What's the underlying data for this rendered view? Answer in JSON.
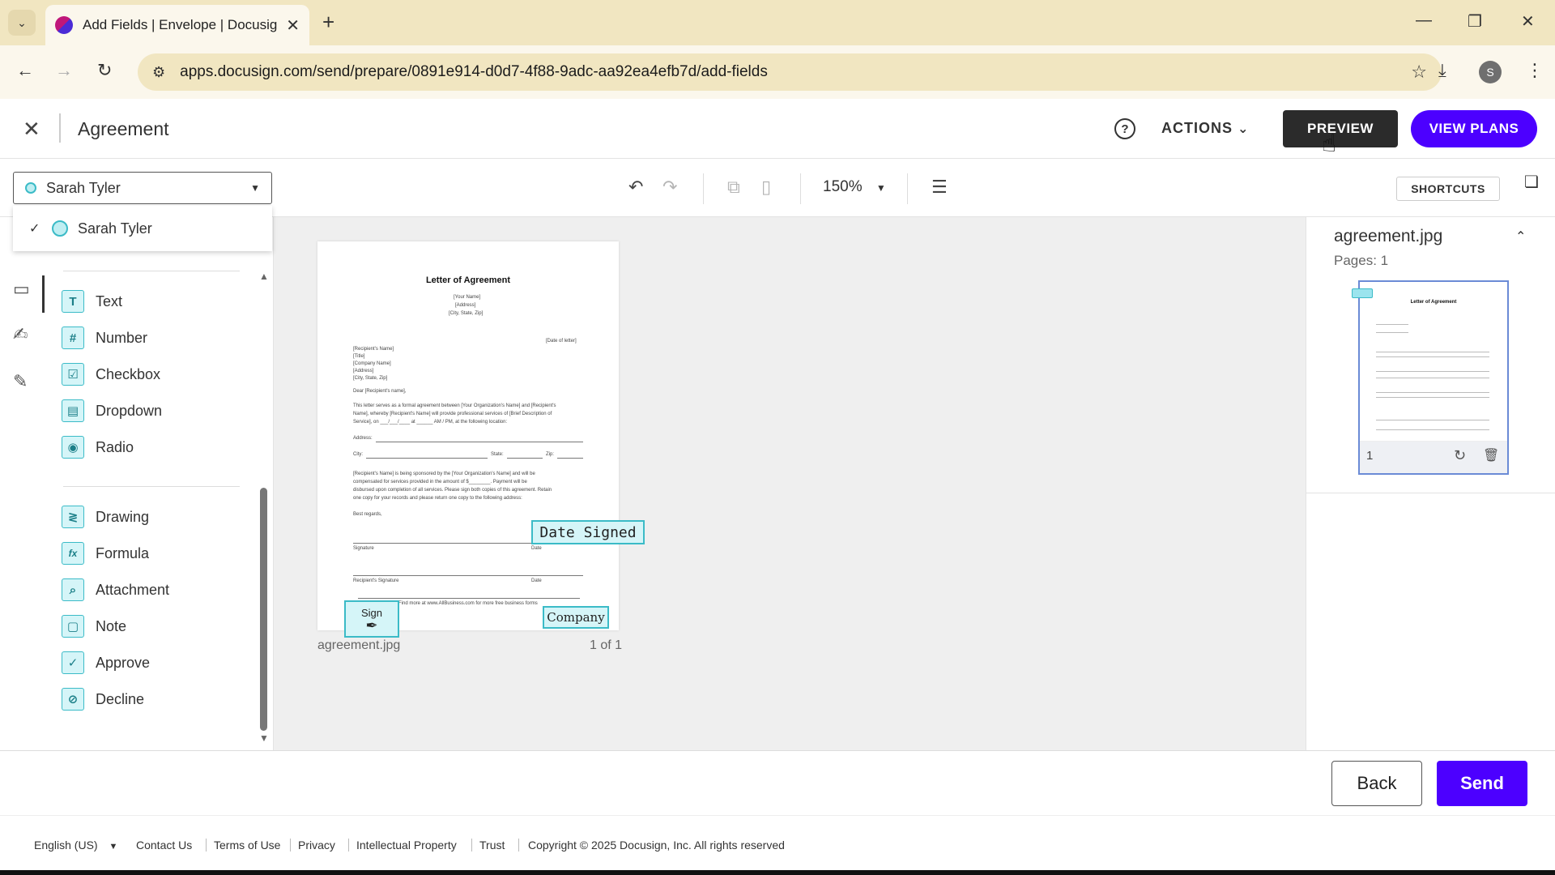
{
  "browser": {
    "tab_title": "Add Fields | Envelope | Docusig",
    "url": "apps.docusign.com/send/prepare/0891e914-d0d7-4f88-9adc-aa92ea4efb7d/add-fields",
    "profile_initial": "S"
  },
  "header": {
    "title": "Agreement",
    "actions_label": "ACTIONS",
    "preview_label": "PREVIEW",
    "view_plans_label": "VIEW PLANS"
  },
  "toolbar": {
    "recipient": "Sarah Tyler",
    "zoom": "150%",
    "shortcuts_label": "SHORTCUTS"
  },
  "recipient_menu": {
    "items": [
      {
        "name": "Sarah Tyler",
        "selected": true
      }
    ]
  },
  "palette": {
    "standard_fields": [
      {
        "label": "Text",
        "icon": "T"
      },
      {
        "label": "Number",
        "icon": "#"
      },
      {
        "label": "Checkbox",
        "icon": "☑"
      },
      {
        "label": "Dropdown",
        "icon": "▤"
      },
      {
        "label": "Radio",
        "icon": "◉"
      }
    ],
    "advanced_fields": [
      {
        "label": "Drawing",
        "icon": "≷"
      },
      {
        "label": "Formula",
        "icon": "fx"
      },
      {
        "label": "Attachment",
        "icon": "⌕"
      },
      {
        "label": "Note",
        "icon": "▢"
      },
      {
        "label": "Approve",
        "icon": "✓"
      },
      {
        "label": "Decline",
        "icon": "⊘"
      }
    ]
  },
  "document": {
    "heading": "Letter of Agreement",
    "sender_lines": [
      "[Your Name]",
      "[Address]",
      "[City, State, Zip]"
    ],
    "date_line": "[Date of letter]",
    "recipient_lines": [
      "[Recipient's Name]",
      "[Title]",
      "[Company Name]",
      "[Address]",
      "[City, State, Zip]"
    ],
    "salutation": "Dear [Recipient's name],",
    "body1": [
      "This letter serves as a formal agreement between [Your Organization's Name] and [Recipient's",
      "Name], whereby [Recipient's Name] will provide professional services of [Brief Description of",
      "Service], on ___/___/____ at ______ AM / PM, at the following location:"
    ],
    "address_label": "Address:",
    "city_label": "City:",
    "state_label": "State:",
    "zip_label": "Zip:",
    "body2": [
      "[Recipient's Name] is being sponsored by the [Your Organization's Name] and will be",
      "compensated for services provided in the amount of $________. Payment will be",
      "disbursed upon completion of all services. Please sign both copies of this agreement. Retain",
      "one copy for your records and please return one copy to the following address:"
    ],
    "closing": "Best regards,",
    "signature_label": "Signature",
    "date_label": "Date",
    "recipient_signature_label": "Recipient's Signature",
    "footer_note": "Find more at www.AllBusiness.com for more free business forms",
    "filename": "agreement.jpg",
    "page_count": "1 of 1",
    "tags": {
      "date_signed": "Date Signed",
      "company": "Company",
      "sign": "Sign"
    }
  },
  "right_panel": {
    "filename": "agreement.jpg",
    "pages_label": "Pages: 1",
    "thumb_title": "Letter of Agreement",
    "page_number": "1"
  },
  "actions": {
    "back_label": "Back",
    "send_label": "Send"
  },
  "footer": {
    "language": "English (US)",
    "links": [
      "Contact Us",
      "Terms of Use",
      "Privacy",
      "Intellectual Property",
      "Trust"
    ],
    "copyright": "Copyright © 2025 Docusign, Inc. All rights reserved"
  },
  "colors": {
    "brand": "#4c00ff",
    "field_tag": "#d5f5f8",
    "field_border": "#3bbbc7"
  }
}
